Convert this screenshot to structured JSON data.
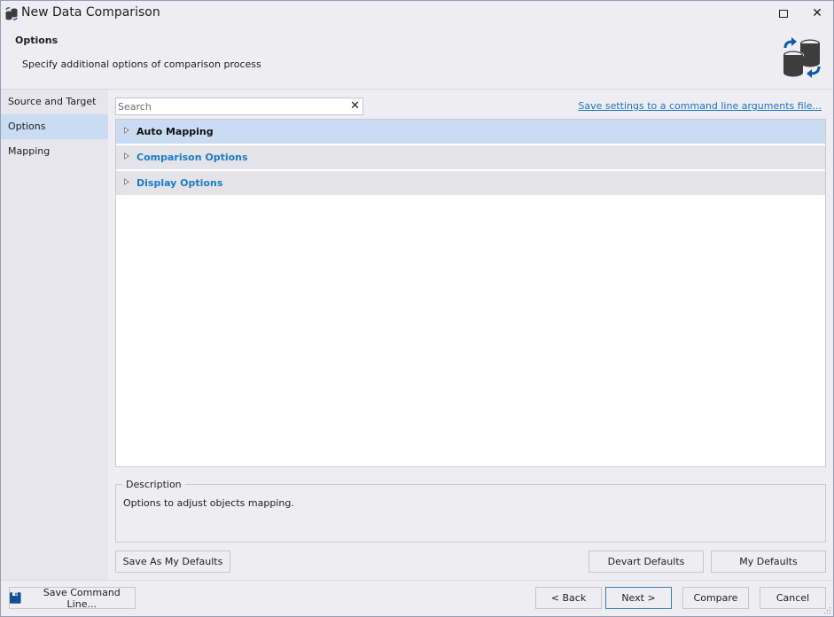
{
  "window": {
    "title": "New Data Comparison",
    "icons": {
      "app": "database-compare-icon",
      "maximize": "maximize-icon",
      "close": "close-icon"
    },
    "close_glyph": "✕"
  },
  "header": {
    "title": "Options",
    "subtitle": "Specify additional options of comparison process",
    "icon": "database-sync-icon"
  },
  "sidebar": {
    "items": [
      {
        "label": "Source and Target",
        "active": false
      },
      {
        "label": "Options",
        "active": true
      },
      {
        "label": "Mapping",
        "active": false
      }
    ]
  },
  "search": {
    "value": "",
    "placeholder": "Search",
    "clear_glyph": "✕"
  },
  "save_settings_link": "Save settings to a command line arguments file...",
  "options": {
    "groups": [
      {
        "label": "Auto Mapping",
        "selected": true,
        "expanded": false
      },
      {
        "label": "Comparison Options",
        "selected": false,
        "expanded": false
      },
      {
        "label": "Display Options",
        "selected": false,
        "expanded": false
      }
    ]
  },
  "description": {
    "legend": "Description",
    "text": "Options to adjust objects mapping."
  },
  "defaults_buttons": {
    "save_as_my_defaults": "Save As My Defaults",
    "devart_defaults": "Devart Defaults",
    "my_defaults": "My Defaults"
  },
  "footer": {
    "save_command_line": "Save Command Line...",
    "back": "< Back",
    "next": "Next >",
    "compare": "Compare",
    "cancel": "Cancel"
  },
  "colors": {
    "accent": "#1a73c6",
    "selection": "#c9dcf2",
    "group_label": "#1b7ac7",
    "icon_blue": "#0e5aa7",
    "icon_dark": "#3d3d3d"
  }
}
